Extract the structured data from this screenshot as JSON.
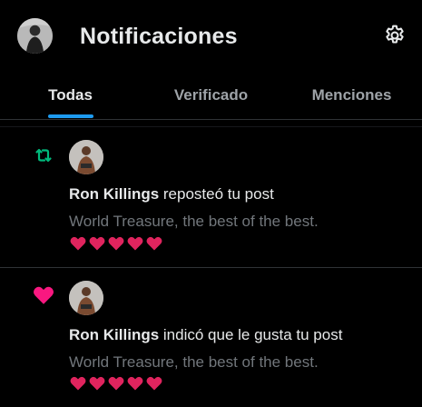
{
  "header": {
    "title": "Notificaciones",
    "avatar_icon": "user-avatar",
    "settings_icon": "gear-icon"
  },
  "tabs": [
    {
      "label": "Todas",
      "active": true
    },
    {
      "label": "Verificado",
      "active": false
    },
    {
      "label": "Menciones",
      "active": false
    }
  ],
  "notifications": [
    {
      "type_icon": "repost-icon",
      "icon_color": "#00ba7c",
      "user": "Ron Killings",
      "action": " reposteó tu post",
      "post_text": "World Treasure, the best of the best.",
      "hearts": "❤️❤️❤️❤️❤️"
    },
    {
      "type_icon": "heart-icon",
      "icon_color": "#f91880",
      "user": "Ron Killings",
      "action": " indicó que le gusta tu post",
      "post_text": "World Treasure, the best of the best.",
      "hearts": "❤️❤️❤️❤️❤️"
    }
  ],
  "colors": {
    "accent": "#1d9bf0",
    "background": "#000000",
    "muted_text": "#71767b",
    "heart_red": "#e0245e"
  }
}
